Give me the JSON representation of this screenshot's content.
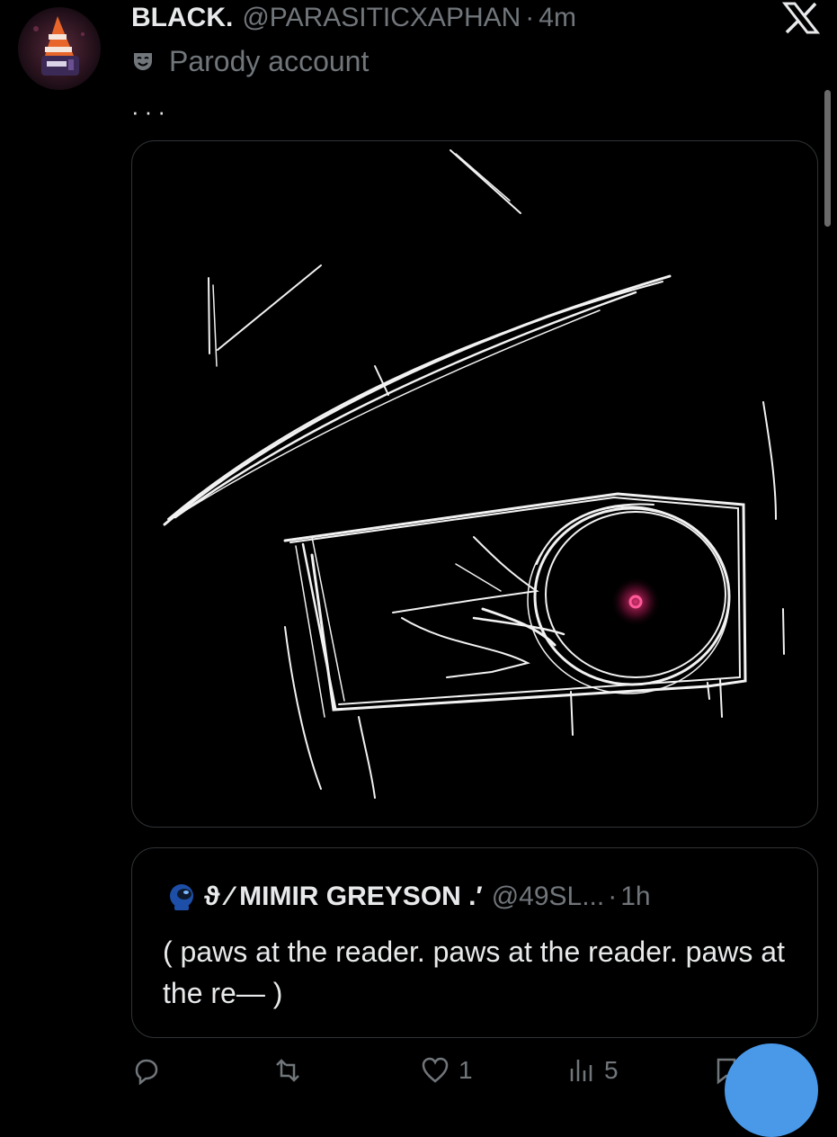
{
  "post": {
    "display_name": "BLACK.",
    "handle": "@PARASITICXAPHAN",
    "separator": "·",
    "time": "4m",
    "label_icon": "theater-mask-icon",
    "label": "Parody account",
    "more_label": "···"
  },
  "window": {
    "close_icon": "x-close-icon"
  },
  "media": {
    "accent_color": "#e0336f",
    "stroke_color": "#f2f2f2"
  },
  "quote": {
    "badge_icon": "astronaut-icon",
    "display_name": "ϑ ⁄ MIMIR GREYSON .′",
    "handle": "@49SL...",
    "separator": "·",
    "time": "1h",
    "text": "( paws at the reader. paws at the reader. paws at the re— )"
  },
  "actions": {
    "reply_icon": "reply-icon",
    "repost_icon": "repost-icon",
    "like_icon": "heart-icon",
    "like_count": "1",
    "views_icon": "views-icon",
    "views_count": "5",
    "bookmark_icon": "bookmark-icon",
    "compose_icon": "compose-icon"
  },
  "colors": {
    "background": "#000000",
    "text_primary": "#e7e9ea",
    "text_secondary": "#71767b",
    "border": "#2f3336",
    "accent_blue": "#4a99e9"
  }
}
